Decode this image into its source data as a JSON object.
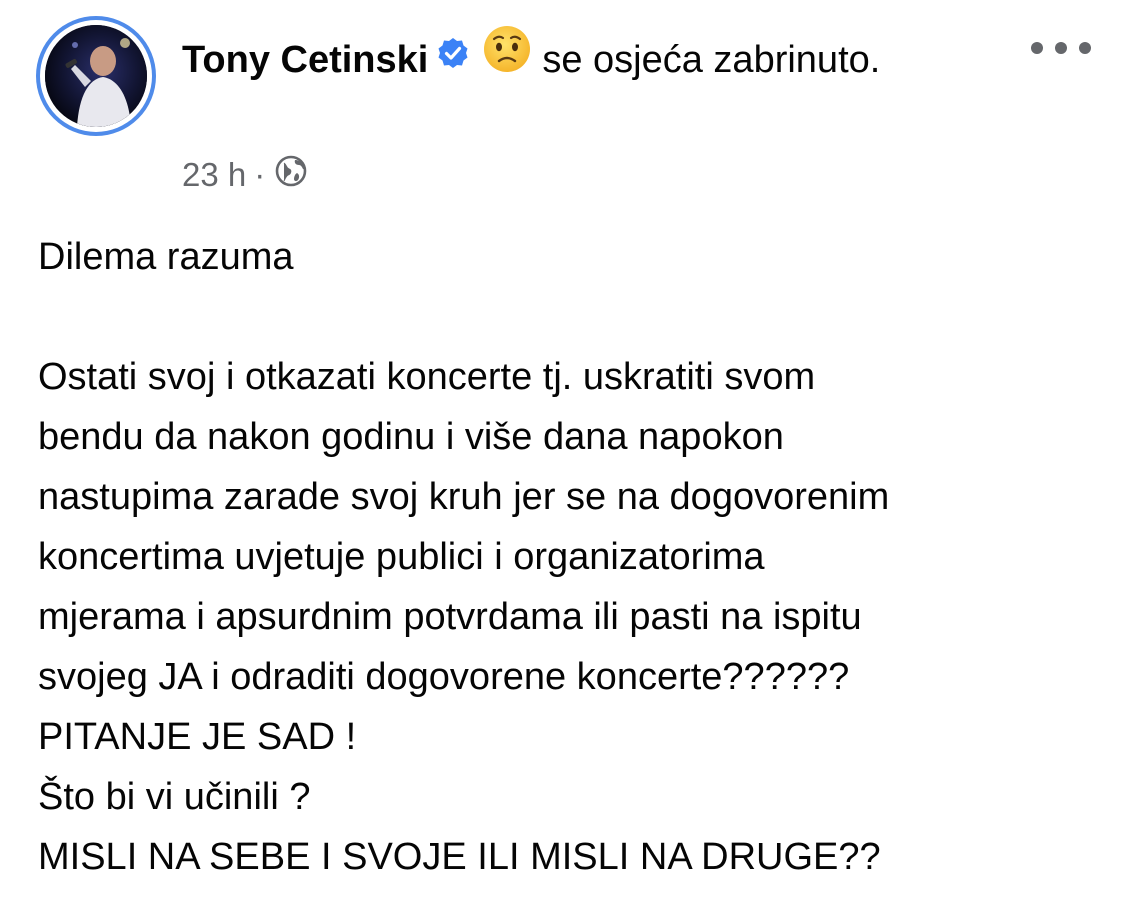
{
  "post": {
    "author": {
      "name": "Tony Cetinski",
      "verified": true,
      "feeling_prefix": "se osjeća",
      "feeling_text": "se osjeća zabrinuto.",
      "feeling_emoji": "worried-face-icon"
    },
    "timestamp": "23 h",
    "separator": "·",
    "audience_icon": "globe-icon",
    "title": "Dilema razuma",
    "body_lines": [
      "Ostati svoj i otkazati koncerte tj. uskratiti svom",
      "bendu da nakon godinu i više dana napokon",
      "nastupima zarade svoj kruh jer se na dogovorenim",
      "koncertima uvjetuje publici i organizatorima",
      "mjerama i apsurdnim potvrdama ili pasti na ispitu",
      "svojeg JA i odraditi dogovorene koncerte??????",
      "PITANJE JE SAD !",
      "Što bi vi učinili ?",
      "MISLI NA SEBE I SVOJE ILI MISLI NA DRUGE??"
    ]
  },
  "colors": {
    "text": "#050505",
    "secondary_text": "#65676b",
    "accent": "#4f8bea"
  }
}
